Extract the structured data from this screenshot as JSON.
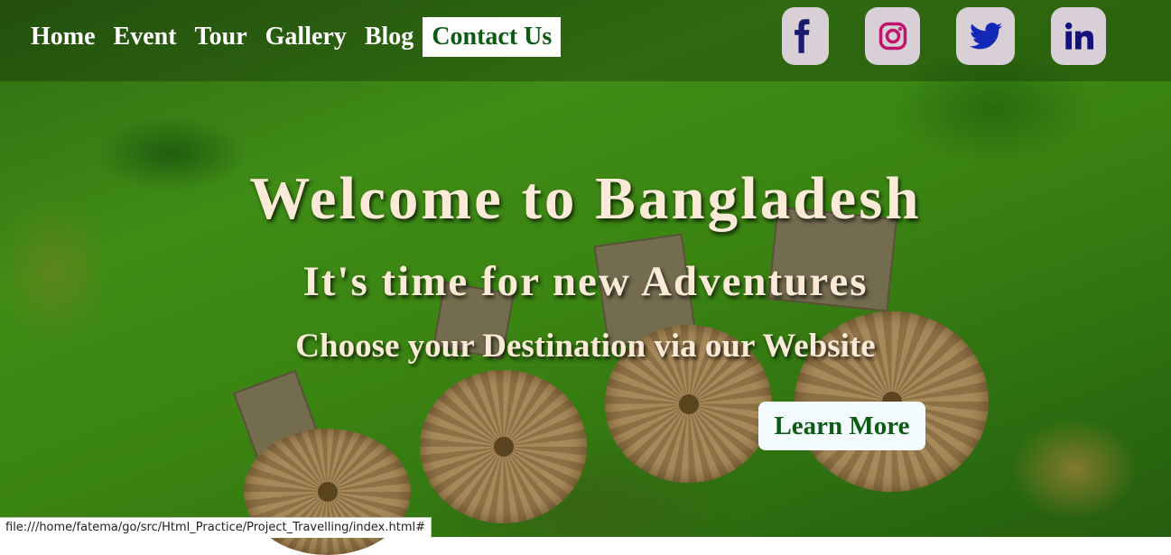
{
  "nav": {
    "items": [
      {
        "label": "Home"
      },
      {
        "label": "Event"
      },
      {
        "label": "Tour"
      },
      {
        "label": "Gallery"
      },
      {
        "label": "Blog"
      },
      {
        "label": "Contact Us",
        "active": true
      }
    ]
  },
  "social": [
    {
      "icon": "facebook-icon",
      "color": "#1a1a6e"
    },
    {
      "icon": "instagram-icon",
      "color": "#c0146a"
    },
    {
      "icon": "twitter-icon",
      "color": "#1428b8"
    },
    {
      "icon": "linkedin-icon",
      "color": "#12127a"
    }
  ],
  "hero": {
    "title": "Welcome to Bangladesh",
    "subtitle": "It's time for new Adventures",
    "tagline": "Choose your Destination via our Website",
    "cta_label": "Learn More"
  },
  "status_bar": {
    "url": "file:///home/fatema/go/src/Html_Practice/Project_Travelling/index.html#"
  },
  "colors": {
    "heading_text": "#fbead8",
    "accent_green": "#0b5b12",
    "button_bg": "#f3fbff",
    "social_bg": "#d9cfd6"
  }
}
